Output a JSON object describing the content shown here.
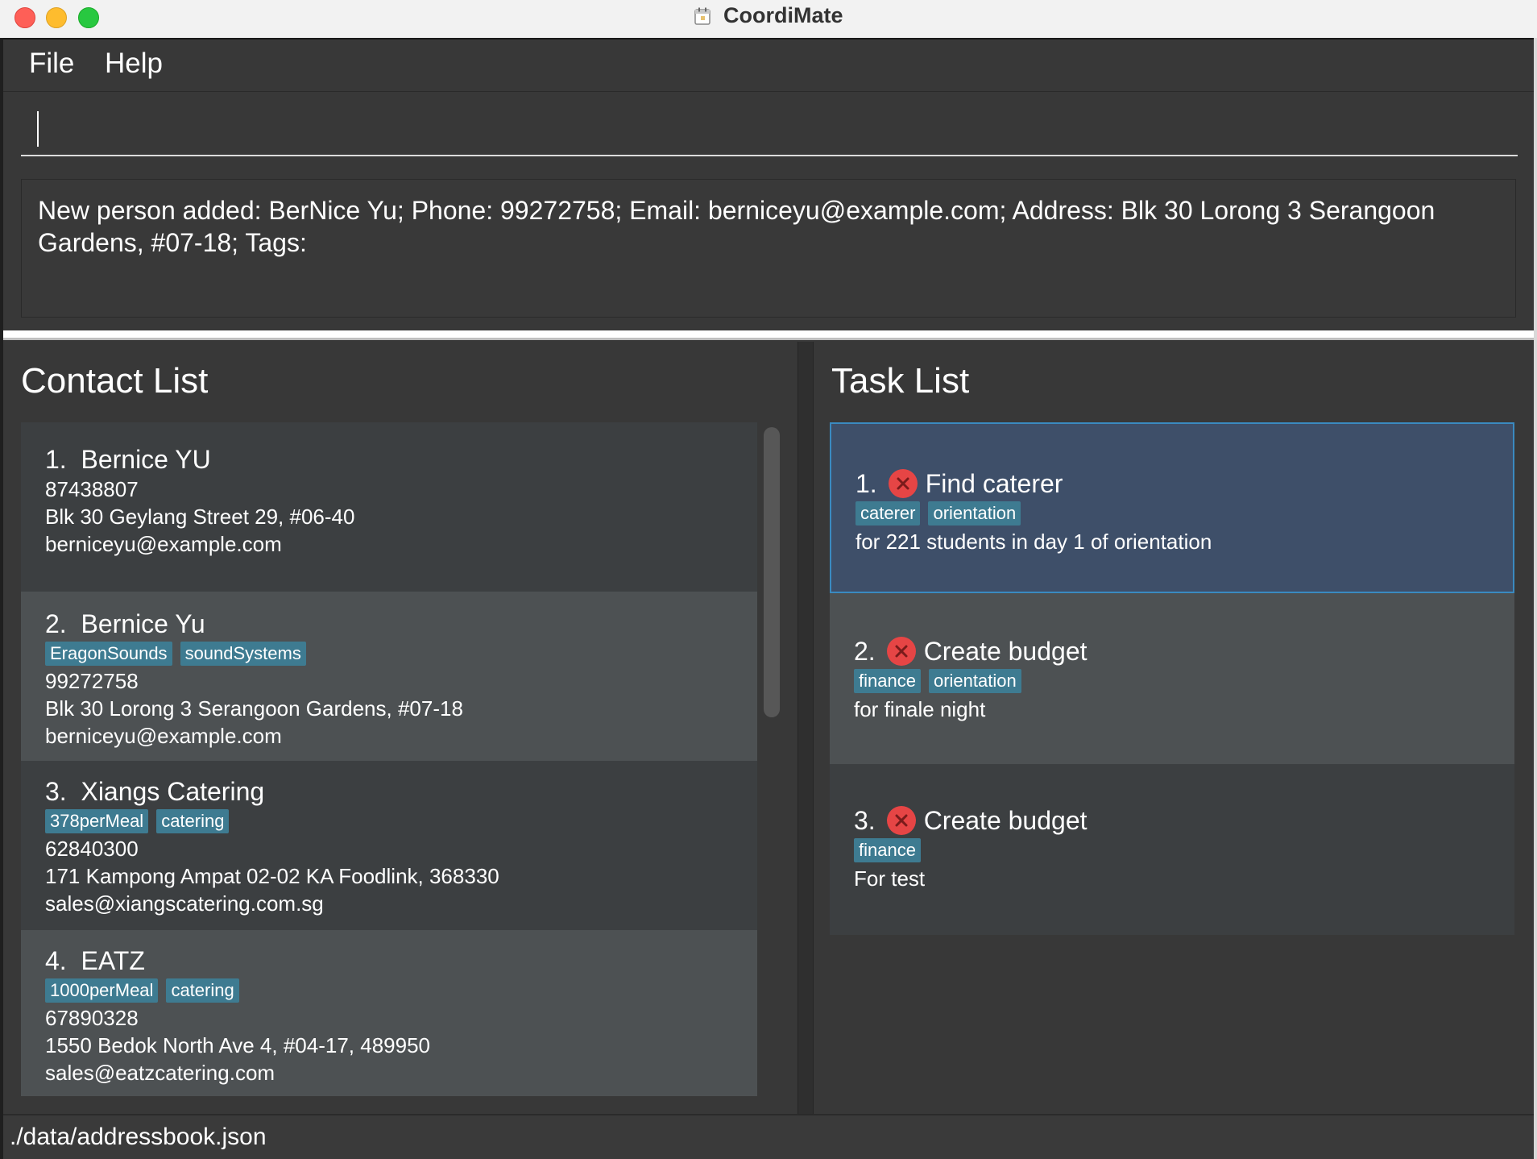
{
  "window": {
    "title": "CoordiMate",
    "title_icon": "calendar-icon"
  },
  "menu": {
    "items": [
      "File",
      "Help"
    ]
  },
  "command": {
    "value": "",
    "placeholder": ""
  },
  "result": {
    "message": "New person added: BerNice Yu; Phone: 99272758; Email: berniceyu@example.com; Address: Blk 30 Lorong 3 Serangoon Gardens, #07-18; Tags:"
  },
  "contacts": {
    "title": "Contact List",
    "items": [
      {
        "index": "1.",
        "name": "Bernice YU",
        "tags": [],
        "phone": "87438807",
        "address": "Blk 30 Geylang Street 29, #06-40",
        "email": "berniceyu@example.com"
      },
      {
        "index": "2.",
        "name": "Bernice Yu",
        "tags": [
          "EragonSounds",
          "soundSystems"
        ],
        "phone": "99272758",
        "address": "Blk 30 Lorong 3 Serangoon Gardens, #07-18",
        "email": "berniceyu@example.com"
      },
      {
        "index": "3.",
        "name": "Xiangs Catering",
        "tags": [
          "378perMeal",
          "catering"
        ],
        "phone": "62840300",
        "address": "171 Kampong Ampat 02-02 KA Foodlink, 368330",
        "email": "sales@xiangscatering.com.sg"
      },
      {
        "index": "4.",
        "name": "EATZ",
        "tags": [
          "1000perMeal",
          "catering"
        ],
        "phone": "67890328",
        "address": "1550 Bedok North Ave 4, #04-17, 489950",
        "email": "sales@eatzcatering.com"
      }
    ]
  },
  "tasks": {
    "title": "Task List",
    "status_icon": "not-done-x-icon",
    "items": [
      {
        "index": "1.",
        "title": "Find caterer",
        "tags": [
          "caterer",
          "orientation"
        ],
        "note": "for 221 students in day 1 of orientation",
        "selected": true
      },
      {
        "index": "2.",
        "title": "Create budget",
        "tags": [
          "finance",
          "orientation"
        ],
        "note": "for finale night",
        "selected": false
      },
      {
        "index": "3.",
        "title": "Create budget",
        "tags": [
          "finance"
        ],
        "note": "For test",
        "selected": false
      }
    ]
  },
  "status": {
    "file_path": "./data/addressbook.json"
  },
  "colors": {
    "background": "#383838",
    "card_dark": "#3c3f41",
    "card_light": "#4d5153",
    "tag": "#3e7b91",
    "selected_task": "#3e4f69",
    "selected_border": "#3a8ac0",
    "not_done": "#e64545"
  }
}
